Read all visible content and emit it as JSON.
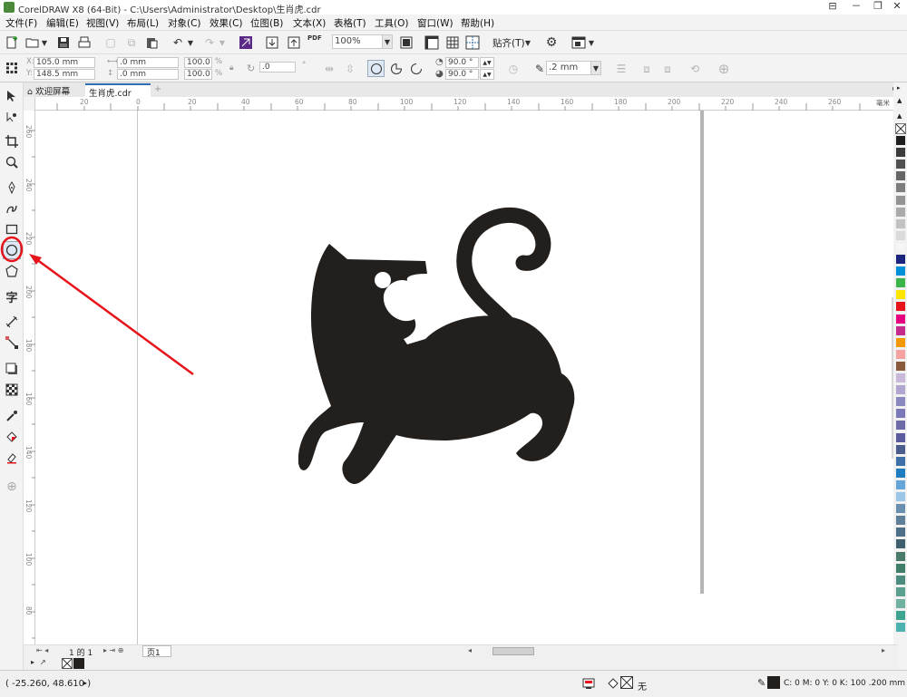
{
  "title": "CorelDRAW X8 (64-Bit) - C:\\Users\\Administrator\\Desktop\\生肖虎.cdr",
  "window_buttons": [
    "⊟",
    "－",
    "❐",
    "✕"
  ],
  "menu": [
    "文件(F)",
    "编辑(E)",
    "视图(V)",
    "布局(L)",
    "对象(C)",
    "效果(C)",
    "位图(B)",
    "文本(X)",
    "表格(T)",
    "工具(O)",
    "窗口(W)",
    "帮助(H)"
  ],
  "toolbar": {
    "zoom": "100%",
    "pdf_label": "PDF",
    "snap_label": "贴齐(T)"
  },
  "propbar": {
    "x": "105.0 mm",
    "y": "148.5 mm",
    "w": ".0 mm",
    "h": ".0 mm",
    "sx": "100.0",
    "sy": "100.0",
    "pct1": "%",
    "pct2": "%",
    "angle": ".0",
    "start_angle": "90.0 °",
    "end_angle": "90.0 °",
    "outline_width": ".2 mm"
  },
  "tabs": [
    {
      "label": "欢迎屏幕",
      "active": false
    },
    {
      "label": "生肖虎.cdr",
      "active": true
    }
  ],
  "hruler_labels": [
    "20",
    "0",
    "20",
    "40",
    "60",
    "80",
    "100",
    "120",
    "140",
    "160",
    "180",
    "200",
    "220",
    "240",
    "260"
  ],
  "hruler_unit": "毫米",
  "vruler_labels": [
    "260",
    "240",
    "220",
    "200",
    "180",
    "160",
    "140",
    "120",
    "100",
    "80",
    "60"
  ],
  "page_nav": {
    "current": "1",
    "of": "的",
    "total": "1",
    "page_tab": "页1"
  },
  "status": {
    "coords": "( -25.260, 48.610 )",
    "fill_none": "无",
    "outline_info": "C: 0 M: 0 Y: 0 K: 100  .200 mm"
  },
  "colors": {
    "shape_fill": "#231f1c",
    "annotation": "#e8141b",
    "accent": "#2f6db5"
  },
  "palette": [
    "#1f1f1f",
    "#3b3b3b",
    "#505050",
    "#666666",
    "#7d7d7d",
    "#939393",
    "#aaaaaa",
    "#c2c2c2",
    "#dadada",
    "#f5f5f5",
    "#1a237e",
    "#0090d8",
    "#39b54a",
    "#ffe600",
    "#e8141b",
    "#e4007f",
    "#c62a8a",
    "#f39800",
    "#f5a3a0",
    "#8a5a3c",
    "#c9b8d9",
    "#b0a6cf",
    "#8b87c0",
    "#7a78b8",
    "#6f6aa8",
    "#5b5a9e",
    "#4a5d8c",
    "#3e6fa8",
    "#1f7cc1",
    "#64a6d9",
    "#9cc6e8",
    "#6a8fb0",
    "#5f7f99",
    "#4c6e86",
    "#3e5f6d",
    "#4a7a6a",
    "#3f7f6a",
    "#4c8c7f",
    "#5aa08f",
    "#6fb2a1",
    "#3ca48f",
    "#4bb2b0"
  ]
}
